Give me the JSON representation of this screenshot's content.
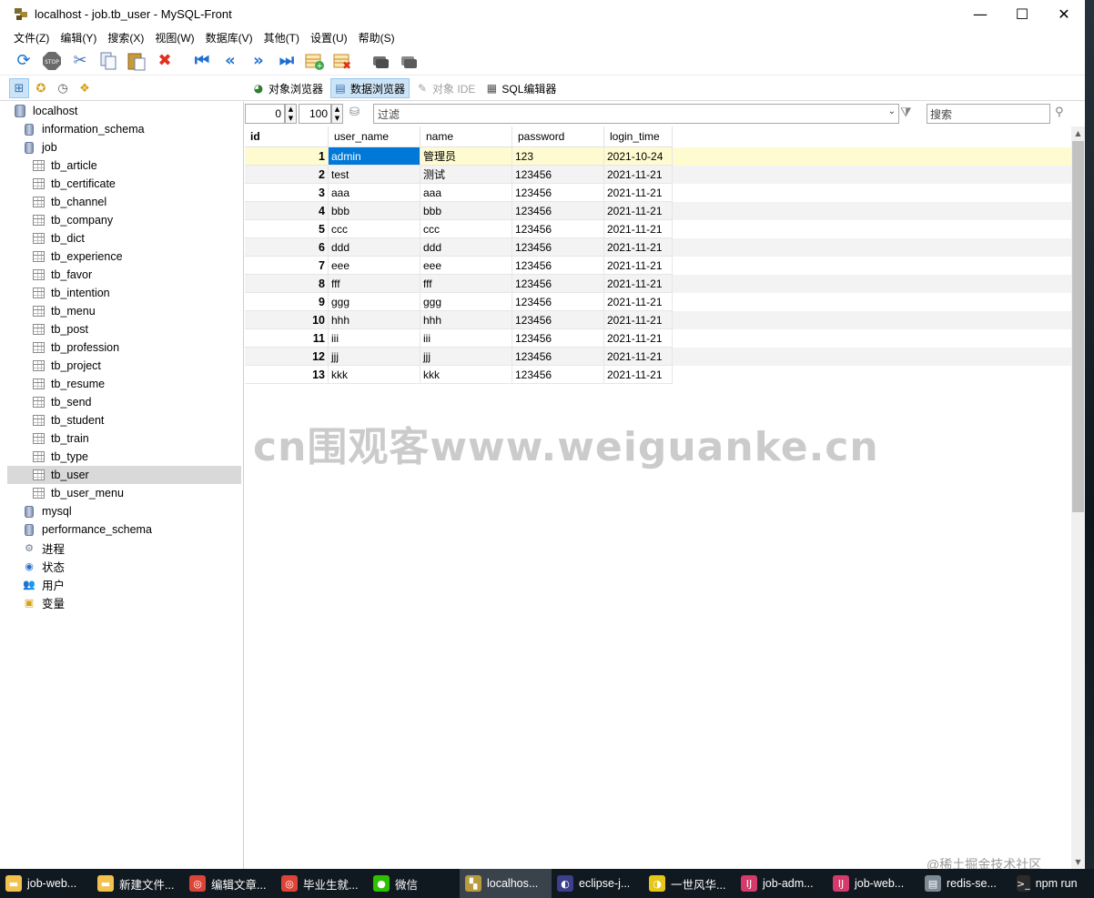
{
  "window": {
    "title": "localhost - job.tb_user - MySQL-Front",
    "minimize_label": "—",
    "maximize_label": "☐",
    "close_label": "✕"
  },
  "menu": [
    "文件(Z)",
    "编辑(Y)",
    "搜索(X)",
    "视图(W)",
    "数据库(V)",
    "其他(T)",
    "设置(U)",
    "帮助(S)"
  ],
  "toolbar_icons": [
    "refresh-icon",
    "stop-icon",
    "cut-icon",
    "copy-icon",
    "paste-icon",
    "delete-icon",
    "first-record-icon",
    "previous-page-icon",
    "next-page-icon",
    "last-record-icon",
    "insert-record-icon",
    "delete-record-icon",
    "commit-icon",
    "rollback-icon"
  ],
  "view_tabs": [
    {
      "label": "对象浏览器",
      "icon": "object-browser-icon",
      "state": "normal"
    },
    {
      "label": "数据浏览器",
      "icon": "data-browser-icon",
      "state": "active"
    },
    {
      "label": "对象 IDE",
      "icon": "object-ide-icon",
      "state": "disabled"
    },
    {
      "label": "SQL编辑器",
      "icon": "sql-editor-icon",
      "state": "normal"
    }
  ],
  "tree": {
    "root": "localhost",
    "databases_before": [
      "information_schema"
    ],
    "current_db": "job",
    "tables": [
      "tb_article",
      "tb_certificate",
      "tb_channel",
      "tb_company",
      "tb_dict",
      "tb_experience",
      "tb_favor",
      "tb_intention",
      "tb_menu",
      "tb_post",
      "tb_profession",
      "tb_project",
      "tb_resume",
      "tb_send",
      "tb_student",
      "tb_train",
      "tb_type",
      "tb_user",
      "tb_user_menu"
    ],
    "selected_table": "tb_user",
    "databases_after": [
      "mysql",
      "performance_schema"
    ],
    "extras": [
      {
        "label": "进程",
        "icon": "processes-icon"
      },
      {
        "label": "状态",
        "icon": "status-icon"
      },
      {
        "label": "用户",
        "icon": "users-icon"
      },
      {
        "label": "变量",
        "icon": "variables-icon"
      }
    ]
  },
  "filter": {
    "offset": "0",
    "limit": "100",
    "filter_placeholder": "过滤",
    "search_placeholder": "搜索"
  },
  "grid": {
    "columns": [
      "id",
      "user_name",
      "name",
      "password",
      "login_time"
    ],
    "rows": [
      [
        "1",
        "admin",
        "管理员",
        "123",
        "2021-10-24"
      ],
      [
        "2",
        "test",
        "测试",
        "123456",
        "2021-11-21"
      ],
      [
        "3",
        "aaa",
        "aaa",
        "123456",
        "2021-11-21"
      ],
      [
        "4",
        "bbb",
        "bbb",
        "123456",
        "2021-11-21"
      ],
      [
        "5",
        "ccc",
        "ccc",
        "123456",
        "2021-11-21"
      ],
      [
        "6",
        "ddd",
        "ddd",
        "123456",
        "2021-11-21"
      ],
      [
        "7",
        "eee",
        "eee",
        "123456",
        "2021-11-21"
      ],
      [
        "8",
        "fff",
        "fff",
        "123456",
        "2021-11-21"
      ],
      [
        "9",
        "ggg",
        "ggg",
        "123456",
        "2021-11-21"
      ],
      [
        "10",
        "hhh",
        "hhh",
        "123456",
        "2021-11-21"
      ],
      [
        "11",
        "iii",
        "iii",
        "123456",
        "2021-11-21"
      ],
      [
        "12",
        "jjj",
        "jjj",
        "123456",
        "2021-11-21"
      ],
      [
        "13",
        "kkk",
        "kkk",
        "123456",
        "2021-11-21"
      ]
    ]
  },
  "watermark": "cn围观客www.weiguanke.cn",
  "credit": "@稀土掘金技术社区",
  "taskbar": [
    {
      "label": "job-web...",
      "icon": "folder-icon",
      "color": "#f2c14e"
    },
    {
      "label": "新建文件...",
      "icon": "folder-icon",
      "color": "#f2c14e"
    },
    {
      "label": "编辑文章...",
      "icon": "chrome-icon",
      "color": "#db4437"
    },
    {
      "label": "毕业生就...",
      "icon": "chrome-icon",
      "color": "#db4437"
    },
    {
      "label": "微信",
      "icon": "wechat-icon",
      "color": "#2dc100"
    },
    {
      "label": "localhos...",
      "icon": "mysql-front-icon",
      "color": "#b89b3c"
    },
    {
      "label": "eclipse-j...",
      "icon": "eclipse-icon",
      "color": "#3b3f8c"
    },
    {
      "label": "一世风华...",
      "icon": "player-icon",
      "color": "#e6c619"
    },
    {
      "label": "job-adm...",
      "icon": "intellij-icon",
      "color": "#d63a6a"
    },
    {
      "label": "job-web...",
      "icon": "intellij-icon",
      "color": "#d63a6a"
    },
    {
      "label": "redis-se...",
      "icon": "redis-window-icon",
      "color": "#7d8a96"
    },
    {
      "label": "npm run",
      "icon": "terminal-icon",
      "color": "#2b2b2b"
    }
  ],
  "active_task_index": 5
}
